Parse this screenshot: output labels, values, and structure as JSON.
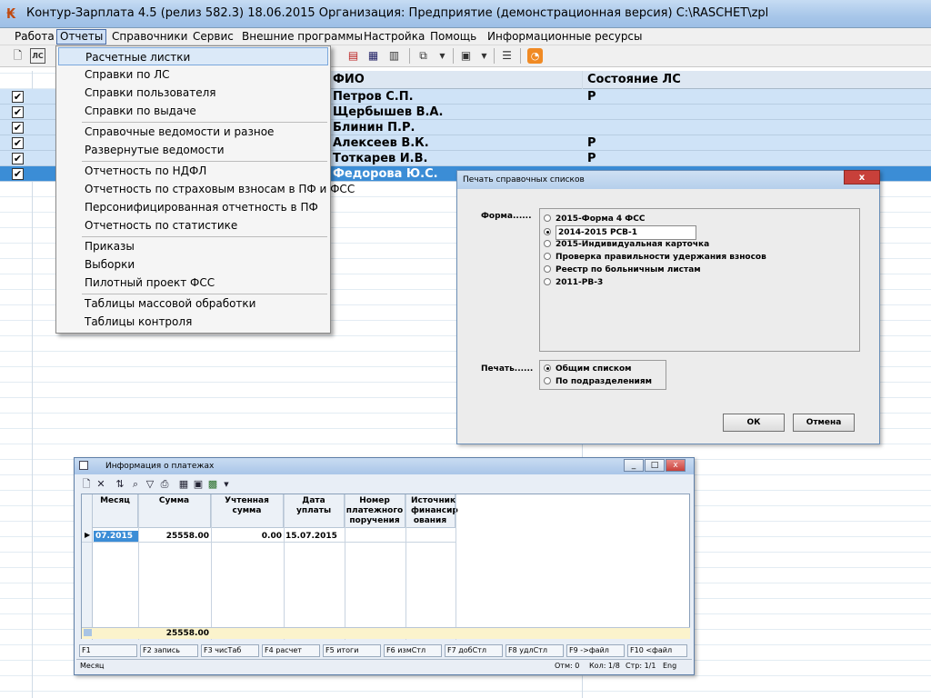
{
  "window": {
    "title": "Контур-Зарплата 4.5 (релиз 582.3) 18.06.2015  Организация: Предприятие (демонстрационная версия) C:\\RASCHET\\zpl"
  },
  "menubar": [
    "Работа",
    "Отчеты",
    "Справочники",
    "Сервис",
    "Внешние программы",
    "Настройка",
    "Помощь",
    "Информационные ресурсы"
  ],
  "toolbar": {
    "left_icon_label": "ЛС",
    "icons": [
      "new-doc-icon",
      "ls-icon",
      "print-icon",
      "export-icon",
      "list-icon",
      "copy-icon",
      "dropdown-arrow-icon",
      "filter-icon",
      "dropdown-arrow-icon",
      "table-icon",
      "rss-icon"
    ]
  },
  "grid": {
    "col_fio": "ФИО",
    "col_state": "Состояние ЛС",
    "rows": [
      {
        "name": "Петров С.П.",
        "state": "Р",
        "checked": "✔"
      },
      {
        "name": "Щербышев В.А.",
        "state": "",
        "checked": "✔"
      },
      {
        "name": "Блинин П.Р.",
        "state": "",
        "checked": "✔"
      },
      {
        "name": "Алексеев В.К.",
        "state": "Р",
        "checked": "✔"
      },
      {
        "name": "Тоткарев И.В.",
        "state": "Р",
        "checked": "✔"
      },
      {
        "name": "Федорова Ю.С.",
        "state": "",
        "checked": "✔"
      }
    ]
  },
  "menu_reports": {
    "items": [
      "Расчетные листки",
      "Справки по ЛС",
      "Справки пользователя",
      "Справки по выдаче",
      "Справочные ведомости и разное",
      "Развернутые ведомости",
      "Отчетность по НДФЛ",
      "Отчетность по страховым взносам в ПФ и ФСС",
      "Персонифицированная отчетность в ПФ",
      "Отчетность по статистике",
      "Приказы",
      "Выборки",
      "Пилотный проект ФСС",
      "Таблицы массовой обработки",
      "Таблицы контроля"
    ]
  },
  "print_dialog": {
    "title": "Печать справочных списков",
    "close": "x",
    "form_label": "Форма......",
    "forms": [
      "2015-Форма 4 ФСС",
      "2014-2015 РСВ-1",
      "2015-Индивидуальная карточка",
      "Проверка правильности удержания взносов",
      "Реестр по больничным листам",
      "2011-РВ-3"
    ],
    "form_selected": "2014-2015 РСВ-1",
    "print_label": "Печать......",
    "print_options": [
      "Общим списком",
      "По подразделениям"
    ],
    "print_selected": "Общим списком",
    "ok": "ОК",
    "cancel": "Отмена"
  },
  "payments": {
    "title": "Информация о платежах",
    "win_buttons": [
      "_",
      "□",
      "x"
    ],
    "columns": [
      "Месяц",
      "Сумма",
      "Учтенная сумма",
      "Дата уплаты",
      "Номер платежного поручения",
      "Источник финансир ования"
    ],
    "row": {
      "month": "07.2015",
      "sum": "25558.00",
      "counted": "0.00",
      "date": "15.07.2015"
    },
    "total": "25558.00",
    "fkeys": [
      "F1",
      "F2 запись",
      "F3 чисТаб",
      "F4 расчет",
      "F5 итоги",
      "F6 измСтл",
      "F7 добСтл",
      "F8 удлСтл",
      "F9 ->файл",
      "F10 <файл"
    ],
    "status": {
      "field": "Месяц",
      "otm": "Отм: 0",
      "kol": "Кол: 1/8",
      "str": "Стр: 1/1",
      "lang": "Eng"
    }
  }
}
